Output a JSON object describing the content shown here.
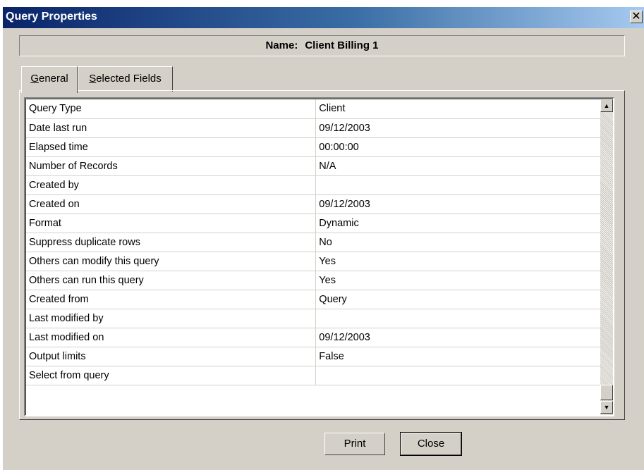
{
  "window": {
    "title": "Query Properties",
    "close_glyph": "✕"
  },
  "name_banner": {
    "label": "Name:",
    "value": "Client Billing 1"
  },
  "tabs": [
    {
      "access_key": "G",
      "rest": "eneral",
      "label": "General",
      "active": true
    },
    {
      "access_key": "S",
      "rest": "elected Fields",
      "label": "Selected Fields",
      "active": false
    }
  ],
  "properties": [
    {
      "name": "Query Type",
      "value": "Client"
    },
    {
      "name": "Date last run",
      "value": "09/12/2003"
    },
    {
      "name": "Elapsed time",
      "value": "00:00:00"
    },
    {
      "name": "Number of Records",
      "value": "N/A"
    },
    {
      "name": "Created by",
      "value": ""
    },
    {
      "name": "Created on",
      "value": "09/12/2003"
    },
    {
      "name": "Format",
      "value": "Dynamic"
    },
    {
      "name": "Suppress duplicate rows",
      "value": "No"
    },
    {
      "name": "Others can modify this query",
      "value": "Yes"
    },
    {
      "name": "Others can run this query",
      "value": "Yes"
    },
    {
      "name": "Created from",
      "value": "Query"
    },
    {
      "name": "Last modified by",
      "value": ""
    },
    {
      "name": "Last modified on",
      "value": "09/12/2003"
    },
    {
      "name": "Output limits",
      "value": "False"
    },
    {
      "name": "Select from query",
      "value": ""
    }
  ],
  "scrollbar": {
    "up_glyph": "▲",
    "down_glyph": "▼"
  },
  "buttons": {
    "print_label": "Print",
    "close_label": "Close"
  },
  "colors": {
    "titlebar_start": "#0a246a",
    "titlebar_end": "#a6caf0",
    "face": "#d4d0c8"
  }
}
